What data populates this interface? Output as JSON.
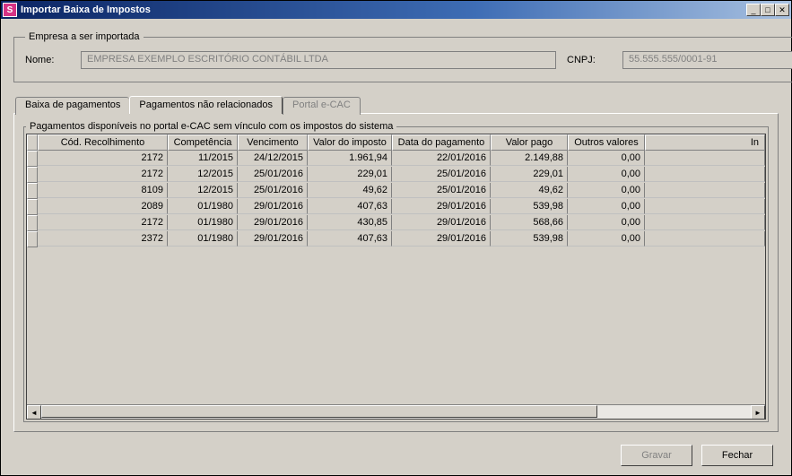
{
  "window": {
    "title": "Importar Baixa de Impostos",
    "icon_letter": "S"
  },
  "company_group": {
    "legend": "Empresa a ser importada",
    "nome_label": "Nome:",
    "nome_value": "EMPRESA EXEMPLO ESCRITÓRIO CONTÁBIL LTDA",
    "cnpj_label": "CNPJ:",
    "cnpj_value": "55.555.555/0001-91"
  },
  "tabs": {
    "baixa": "Baixa de pagamentos",
    "nao_rel": "Pagamentos não relacionados",
    "ecac": "Portal e-CAC"
  },
  "grid": {
    "legend": "Pagamentos disponíveis no portal e-CAC sem vínculo com os impostos do sistema",
    "columns": [
      "Cód. Recolhimento",
      "Competência",
      "Vencimento",
      "Valor do imposto",
      "Data do pagamento",
      "Valor pago",
      "Outros valores",
      "In"
    ],
    "rows": [
      {
        "cod": "2172",
        "comp": "11/2015",
        "venc": "24/12/2015",
        "valor": "1.961,94",
        "data_pag": "22/01/2016",
        "valor_pago": "2.149,88",
        "outros": "0,00"
      },
      {
        "cod": "2172",
        "comp": "12/2015",
        "venc": "25/01/2016",
        "valor": "229,01",
        "data_pag": "25/01/2016",
        "valor_pago": "229,01",
        "outros": "0,00"
      },
      {
        "cod": "8109",
        "comp": "12/2015",
        "venc": "25/01/2016",
        "valor": "49,62",
        "data_pag": "25/01/2016",
        "valor_pago": "49,62",
        "outros": "0,00"
      },
      {
        "cod": "2089",
        "comp": "01/1980",
        "venc": "29/01/2016",
        "valor": "407,63",
        "data_pag": "29/01/2016",
        "valor_pago": "539,98",
        "outros": "0,00"
      },
      {
        "cod": "2172",
        "comp": "01/1980",
        "venc": "29/01/2016",
        "valor": "430,85",
        "data_pag": "29/01/2016",
        "valor_pago": "568,66",
        "outros": "0,00"
      },
      {
        "cod": "2372",
        "comp": "01/1980",
        "venc": "29/01/2016",
        "valor": "407,63",
        "data_pag": "29/01/2016",
        "valor_pago": "539,98",
        "outros": "0,00"
      }
    ]
  },
  "buttons": {
    "gravar": "Gravar",
    "fechar": "Fechar"
  }
}
